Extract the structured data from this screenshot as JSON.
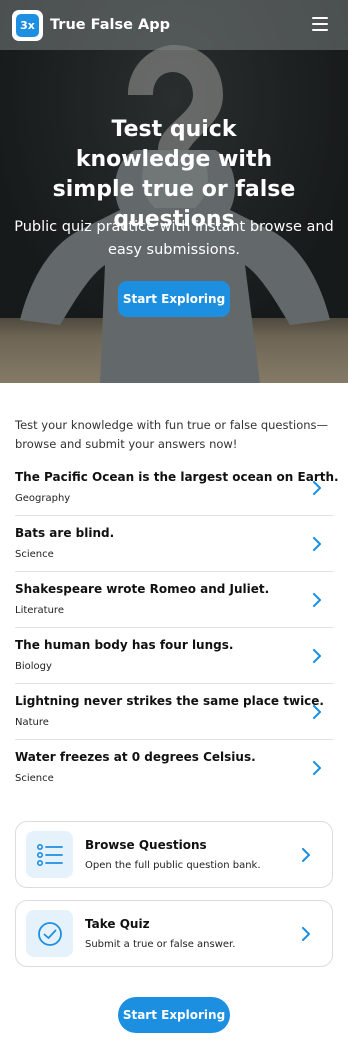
{
  "header": {
    "logo_text": "3x",
    "app_title": "True False App"
  },
  "hero": {
    "title": "Test quick knowledge with simple true or false questions",
    "subtitle": "Public quiz practice with instant browse and easy submissions.",
    "cta_label": "Start Exploring"
  },
  "intro": "Test your knowledge with fun true or false questions—browse and submit your answers now!",
  "questions": [
    {
      "text": "The Pacific Ocean is the largest ocean on Earth.",
      "category": "Geography"
    },
    {
      "text": "Bats are blind.",
      "category": "Science"
    },
    {
      "text": "Shakespeare wrote Romeo and Juliet.",
      "category": "Literature"
    },
    {
      "text": "The human body has four lungs.",
      "category": "Biology"
    },
    {
      "text": "Lightning never strikes the same place twice.",
      "category": "Nature"
    },
    {
      "text": "Water freezes at 0 degrees Celsius.",
      "category": "Science"
    }
  ],
  "cards": {
    "browse": {
      "title": "Browse Questions",
      "desc": "Open the full public question bank.",
      "icon": "list-icon"
    },
    "quiz": {
      "title": "Take Quiz",
      "desc": "Submit a true or false answer.",
      "icon": "check-circle-icon"
    }
  },
  "footer": {
    "cta_label": "Start Exploring"
  },
  "colors": {
    "accent": "#1d8fe1",
    "icon_bg": "#e6f2fb",
    "divider": "#e3e3e3"
  }
}
